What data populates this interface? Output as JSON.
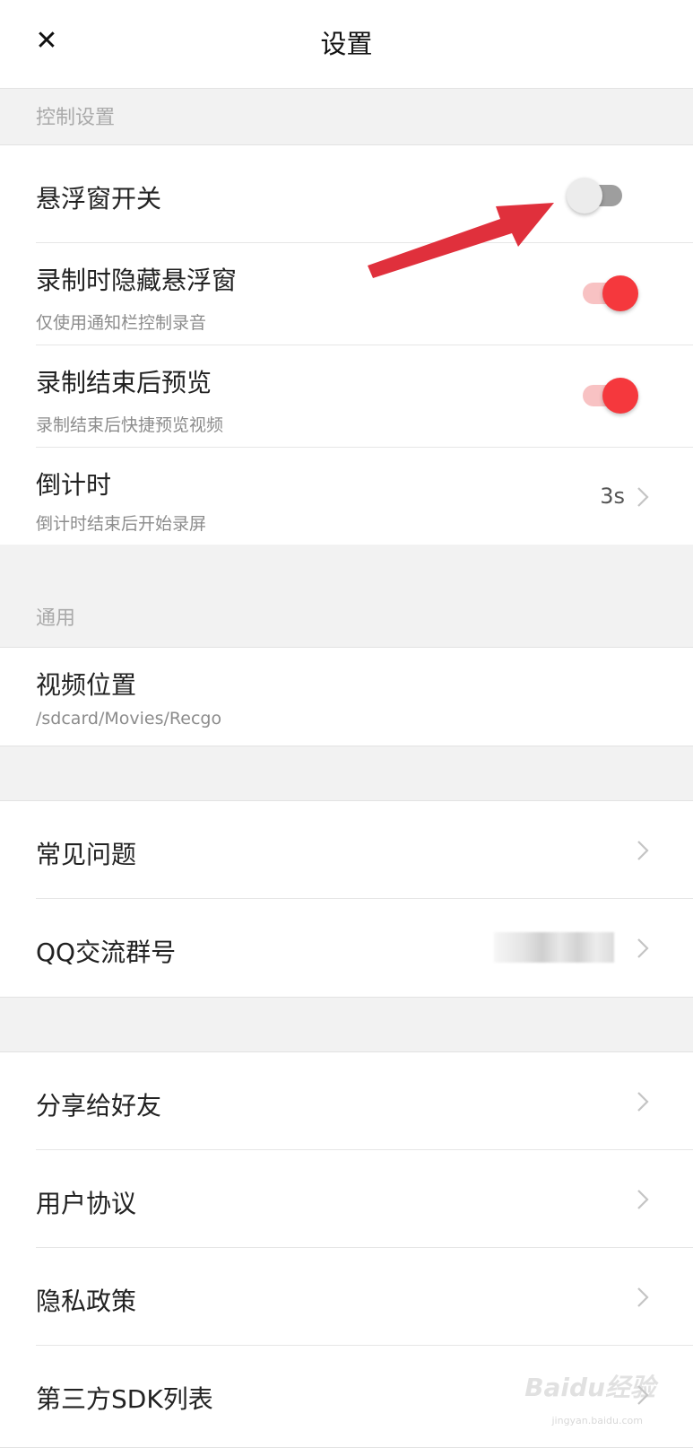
{
  "header": {
    "title": "设置",
    "close_icon": "close-icon"
  },
  "sections": {
    "control": {
      "title": "控制设置"
    },
    "general": {
      "title": "通用"
    }
  },
  "control_items": {
    "float_window": {
      "label": "悬浮窗开关",
      "toggle_on": false
    },
    "hide_float": {
      "label": "录制时隐藏悬浮窗",
      "sub": "仅使用通知栏控制录音",
      "toggle_on": true
    },
    "preview": {
      "label": "录制结束后预览",
      "sub": "录制结束后快捷预览视频",
      "toggle_on": true
    },
    "countdown": {
      "label": "倒计时",
      "sub": "倒计时结束后开始录屏",
      "value": "3s"
    }
  },
  "general_items": {
    "video_location": {
      "label": "视频位置",
      "sub": "/sdcard/Movies/Recgo"
    }
  },
  "help_items": {
    "faq": {
      "label": "常见问题"
    },
    "qq_group": {
      "label": "QQ交流群号"
    }
  },
  "other_items": {
    "share": {
      "label": "分享给好友"
    },
    "user_agreement": {
      "label": "用户协议"
    },
    "privacy": {
      "label": "隐私政策"
    },
    "sdk_list": {
      "label": "第三方SDK列表"
    }
  },
  "watermark": {
    "text": "Baidu经验",
    "sub": "jingyan.baidu.com"
  },
  "colors": {
    "accent": "#f5383d",
    "accent_track": "#f8c2c3",
    "off_track": "#9e9e9e",
    "arrow": "#e0303c",
    "background": "#f2f2f2"
  }
}
